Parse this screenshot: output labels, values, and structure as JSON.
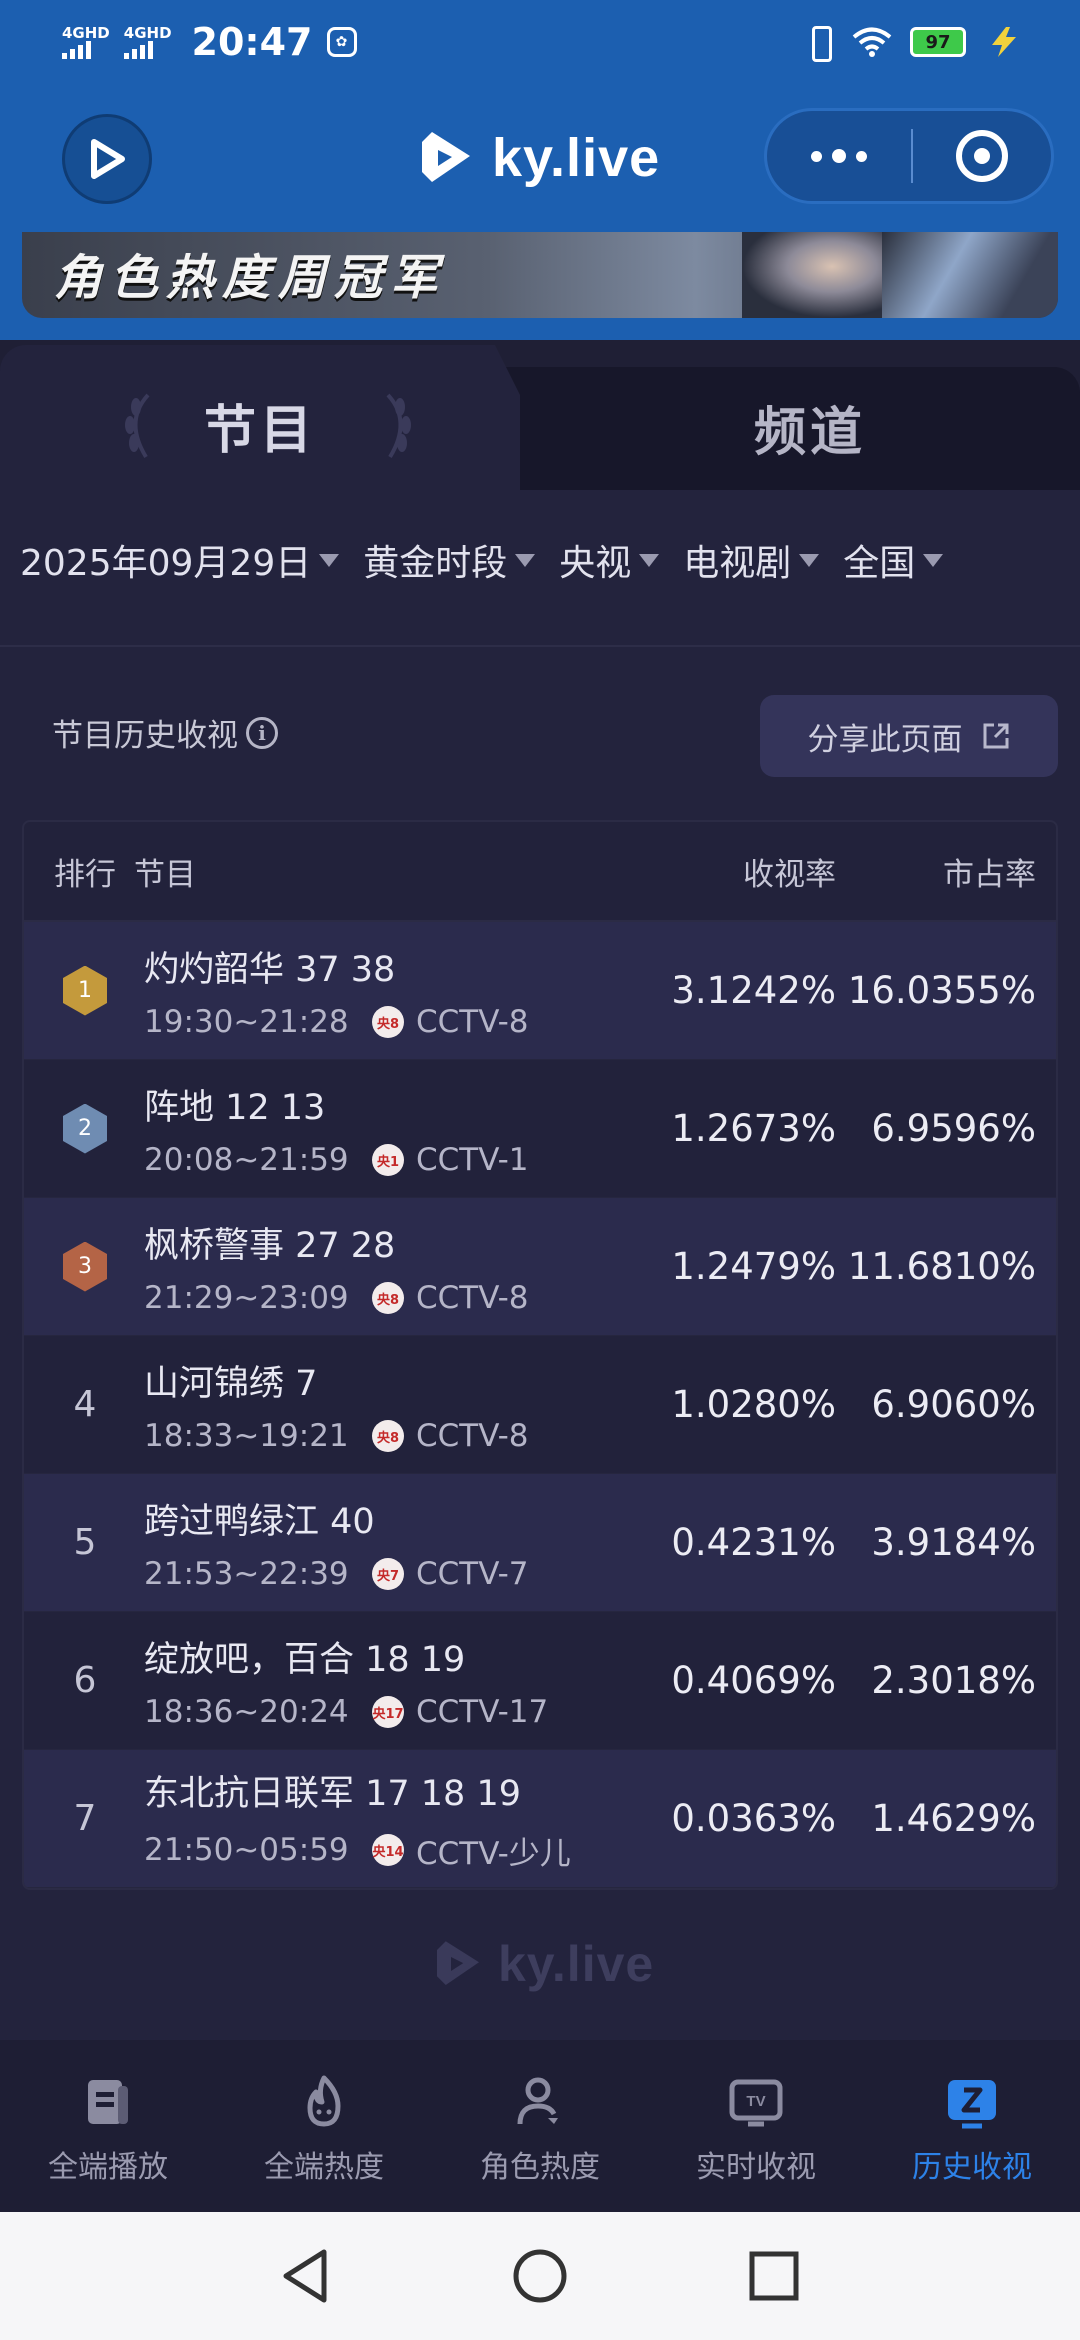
{
  "status_bar": {
    "signal_1": "4GHD",
    "signal_2": "4GHD",
    "time": "20:47",
    "battery": "97"
  },
  "header": {
    "brand": "ky.live"
  },
  "banner": {
    "text": "角色热度周冠军"
  },
  "tabs": [
    {
      "label": "节目",
      "active": true
    },
    {
      "label": "频道",
      "active": false
    }
  ],
  "filters": [
    {
      "label": "2025年09月29日"
    },
    {
      "label": "黄金时段"
    },
    {
      "label": "央视"
    },
    {
      "label": "电视剧"
    },
    {
      "label": "全国"
    }
  ],
  "section": {
    "title": "节目历史收视",
    "share_label": "分享此页面"
  },
  "table": {
    "headers": {
      "rank": "排行",
      "program": "节目",
      "rating": "收视率",
      "share": "市占率"
    },
    "rows": [
      {
        "rank": "1",
        "name": "灼灼韶华 37 38",
        "time": "19:30~21:28",
        "logo": "央8",
        "channel": "CCTV-8",
        "rating": "3.1242%",
        "share": "16.0355%"
      },
      {
        "rank": "2",
        "name": "阵地 12 13",
        "time": "20:08~21:59",
        "logo": "央1",
        "channel": "CCTV-1",
        "rating": "1.2673%",
        "share": "6.9596%"
      },
      {
        "rank": "3",
        "name": "枫桥警事 27 28",
        "time": "21:29~23:09",
        "logo": "央8",
        "channel": "CCTV-8",
        "rating": "1.2479%",
        "share": "11.6810%"
      },
      {
        "rank": "4",
        "name": "山河锦绣 7",
        "time": "18:33~19:21",
        "logo": "央8",
        "channel": "CCTV-8",
        "rating": "1.0280%",
        "share": "6.9060%"
      },
      {
        "rank": "5",
        "name": "跨过鸭绿江 40",
        "time": "21:53~22:39",
        "logo": "央7",
        "channel": "CCTV-7",
        "rating": "0.4231%",
        "share": "3.9184%"
      },
      {
        "rank": "6",
        "name": "绽放吧，百合 18 19",
        "time": "18:36~20:24",
        "logo": "央17",
        "channel": "CCTV-17",
        "rating": "0.4069%",
        "share": "2.3018%"
      },
      {
        "rank": "7",
        "name": "东北抗日联军 17 18 19",
        "time": "21:50~05:59",
        "logo": "央14",
        "channel": "CCTV-少儿",
        "rating": "0.0363%",
        "share": "1.4629%"
      }
    ]
  },
  "footer": {
    "brand": "ky.live"
  },
  "bottom_nav": [
    {
      "label": "全端播放",
      "icon": "play-doc-icon",
      "active": false
    },
    {
      "label": "全端热度",
      "icon": "flame-icon",
      "active": false
    },
    {
      "label": "角色热度",
      "icon": "person-icon",
      "active": false
    },
    {
      "label": "实时收视",
      "icon": "tv-icon",
      "active": false
    },
    {
      "label": "历史收视",
      "icon": "history-icon",
      "active": true
    }
  ],
  "colors": {
    "header_blue": "#1c5fb0",
    "panel_bg": "#23233d",
    "active_nav": "#2d82e8",
    "gold": "#c49a3c",
    "silver": "#6f8cb2",
    "bronze": "#b46446"
  }
}
